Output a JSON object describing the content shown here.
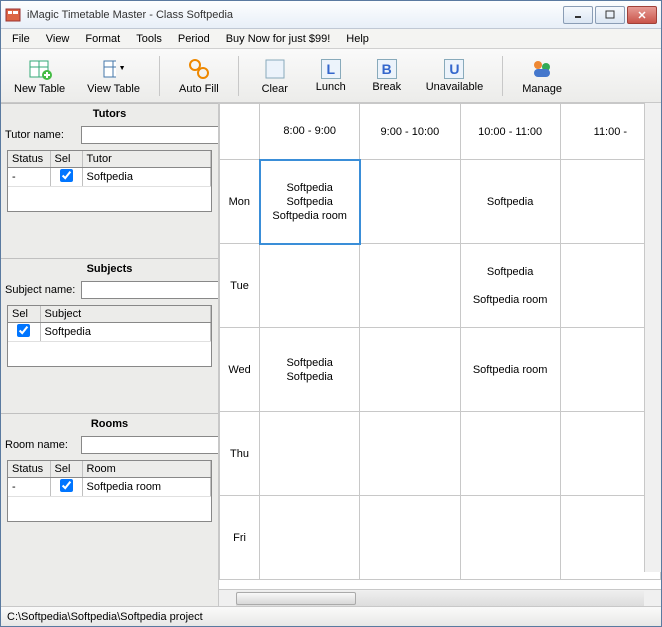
{
  "window": {
    "title": "iMagic Timetable Master - Class Softpedia"
  },
  "menu": [
    "File",
    "View",
    "Format",
    "Tools",
    "Period",
    "Buy Now for just $99!",
    "Help"
  ],
  "toolbar": {
    "new_table": "New Table",
    "view_table": "View Table",
    "auto_fill": "Auto Fill",
    "clear": "Clear",
    "lunch": "Lunch",
    "break": "Break",
    "unavailable": "Unavailable",
    "manage": "Manage"
  },
  "sidebar": {
    "tutors": {
      "heading": "Tutors",
      "name_label": "Tutor name:",
      "name_value": "",
      "cols": [
        "Status",
        "Sel",
        "Tutor"
      ],
      "rows": [
        {
          "status": "-",
          "sel": true,
          "tutor": "Softpedia"
        }
      ]
    },
    "subjects": {
      "heading": "Subjects",
      "name_label": "Subject name:",
      "name_value": "",
      "cols": [
        "Sel",
        "Subject"
      ],
      "rows": [
        {
          "sel": true,
          "subject": "Softpedia"
        }
      ]
    },
    "rooms": {
      "heading": "Rooms",
      "name_label": "Room name:",
      "name_value": "",
      "cols": [
        "Status",
        "Sel",
        "Room"
      ],
      "rows": [
        {
          "status": "-",
          "sel": true,
          "room": "Softpedia room"
        }
      ]
    }
  },
  "timetable": {
    "times": [
      "8:00 - 9:00",
      "9:00 - 10:00",
      "10:00 - 11:00",
      "11:00 -"
    ],
    "days": [
      "Mon",
      "Tue",
      "Wed",
      "Thu",
      "Fri"
    ],
    "cells": {
      "Mon": {
        "0": "Softpedia\nSoftpedia\nSoftpedia room",
        "2": "Softpedia"
      },
      "Tue": {
        "2": "Softpedia\n\nSoftpedia room"
      },
      "Wed": {
        "0": "Softpedia\nSoftpedia",
        "2": "Softpedia room"
      },
      "Thu": {},
      "Fri": {}
    },
    "selected": {
      "day": "Mon",
      "col": 0
    }
  },
  "statusbar": "C:\\Softpedia\\Softpedia\\Softpedia project"
}
